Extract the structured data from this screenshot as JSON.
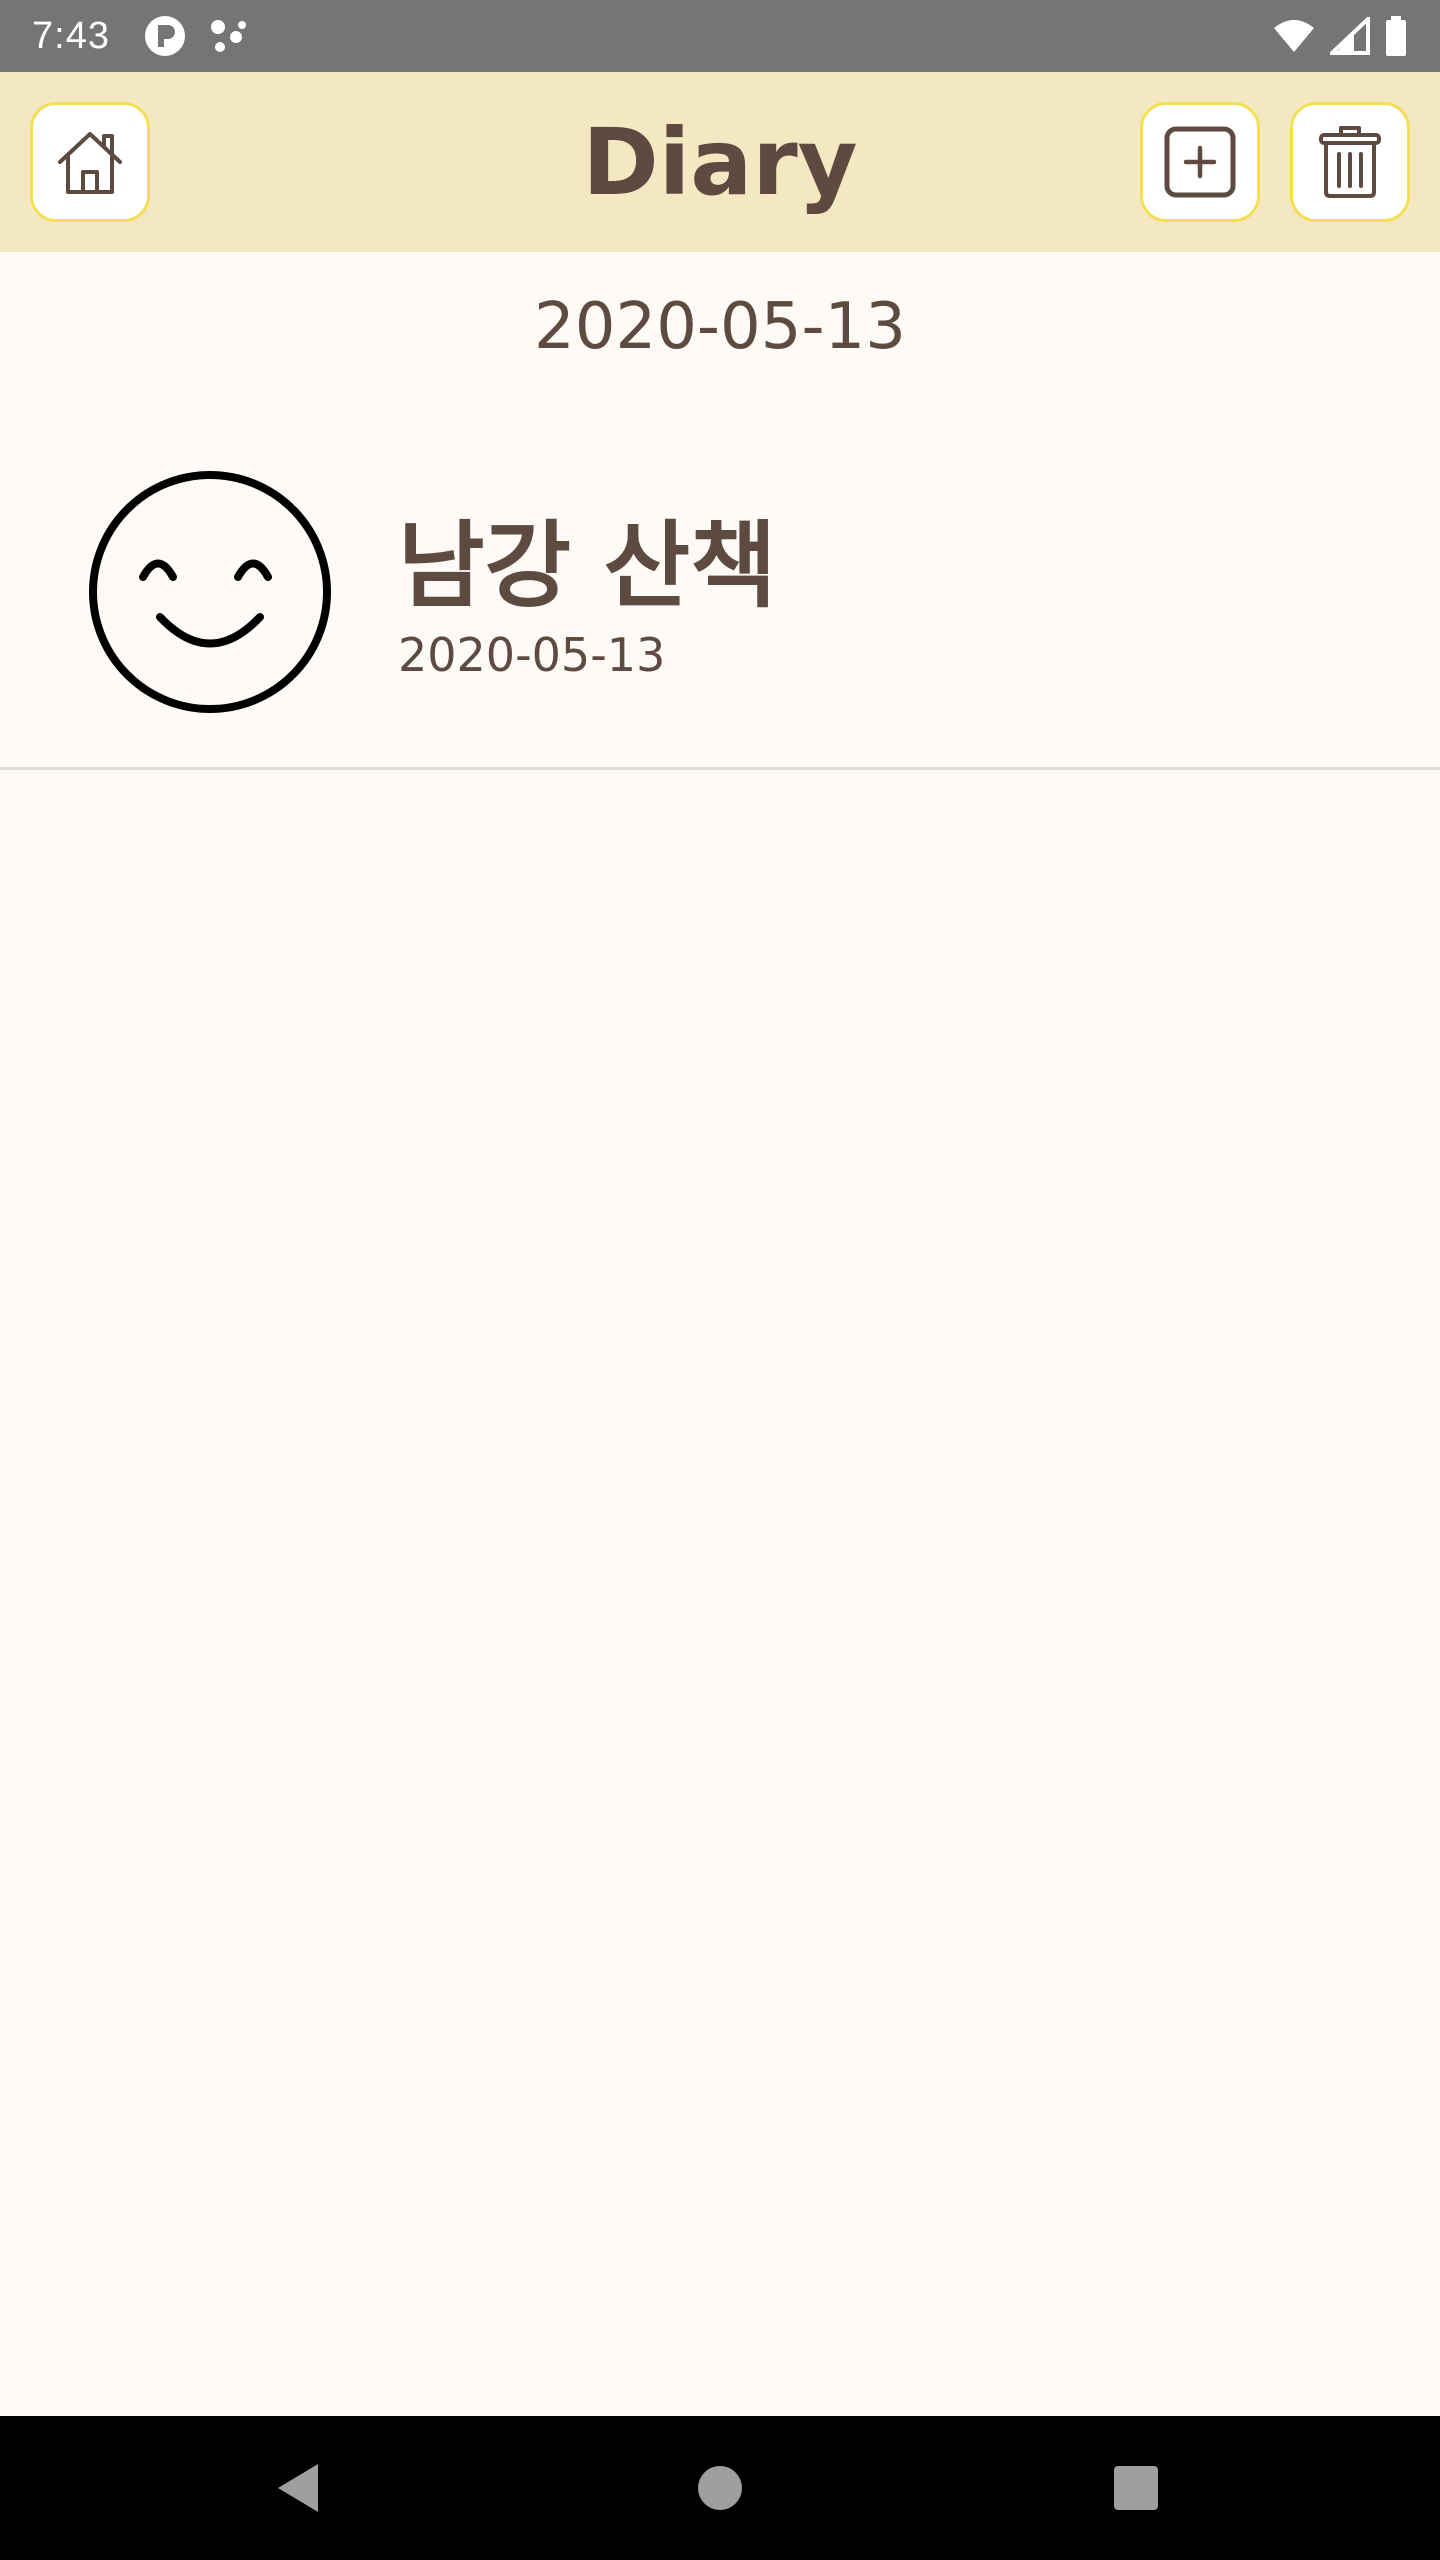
{
  "status_bar": {
    "time": "7:43",
    "left_icons": [
      "p-notification-icon",
      "dots-notification-icon"
    ],
    "right_icons": [
      "wifi-icon",
      "cell-signal-icon",
      "battery-icon"
    ]
  },
  "app_bar": {
    "title": "Diary",
    "home_icon": "home-icon",
    "add_icon": "add-square-icon",
    "delete_icon": "trash-icon"
  },
  "main": {
    "date_header": "2020-05-13",
    "entries": [
      {
        "title": "남강 산책",
        "date": "2020-05-13",
        "mood_icon": "smiley-face-icon"
      }
    ]
  },
  "nav_bar": {
    "icons": [
      "back-triangle-icon",
      "home-circle-icon",
      "recents-square-icon"
    ]
  },
  "colors": {
    "app_bar_bg": "#f4e8c3",
    "page_bg": "#fefbf6",
    "text_brown": "#5d4a40",
    "button_border": "#f2e050"
  }
}
